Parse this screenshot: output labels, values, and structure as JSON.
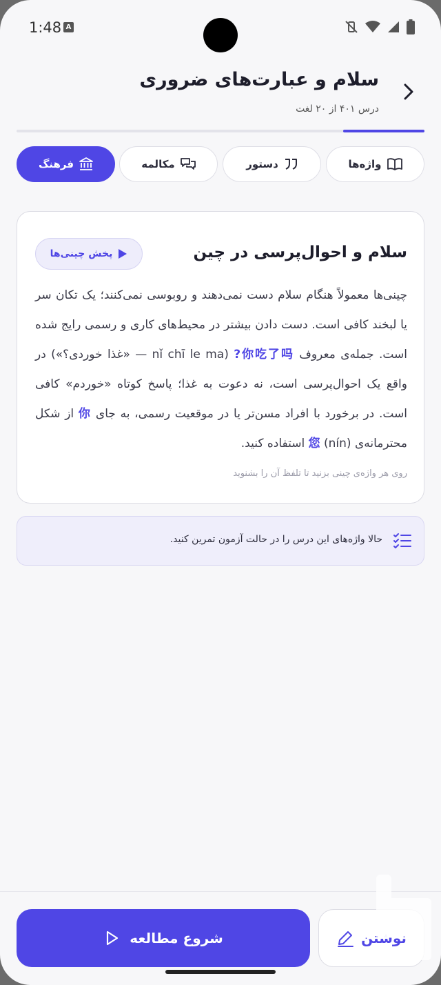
{
  "status_bar": {
    "time": "1:48",
    "a_badge": "A"
  },
  "header": {
    "title": "سلام و عبارت‌های ضروری",
    "subtitle": "درس ۴۰۱ از ۲۰ لغت",
    "progress_percent": 20
  },
  "tabs": [
    {
      "label": "واژه‌ها",
      "icon": "book-icon",
      "active": false
    },
    {
      "label": "دستور",
      "icon": "quote-icon",
      "active": false
    },
    {
      "label": "مکالمه",
      "icon": "chat-icon",
      "active": false
    },
    {
      "label": "فرهنگ",
      "icon": "museum-icon",
      "active": true
    }
  ],
  "card": {
    "title": "سلام و احوال‌پرسی در چین",
    "play_label": "پخش چینی‌ها",
    "body_1": "چینی‌ها معمولاً هنگام سلام دست نمی‌دهند و روبوسی نمی‌کنند؛ یک تکان سر یا لبخند کافی است. دست دادن بیشتر در محیط‌های کاری و رسمی رایج شده است. جمله‌ی معروف ",
    "zh_1": "你吃了吗?",
    "body_2": " (nǐ chī le ma — «غذا خوردی؟») در واقع یک احوال‌پرسی است، نه دعوت به غذا؛ پاسخ کوتاه «خوردم» کافی است. در برخورد با افراد مسن‌تر یا در موقعیت رسمی، به جای ",
    "zh_2": "你",
    "body_3": " از شکل محترمانه‌ی ",
    "zh_3": "您",
    "body_4": " (nín) استفاده کنید.",
    "hint": "روی هر واژه‌ی چینی بزنید تا تلفظ آن را بشنوید"
  },
  "banner": {
    "text": "حالا واژه‌های این درس را در حالت آزمون تمرین کنید."
  },
  "bottom": {
    "start_label": "شروع مطالعه",
    "write_label": "نوشتن"
  },
  "colors": {
    "accent": "#4f46e5",
    "background": "#f7f7f9"
  }
}
